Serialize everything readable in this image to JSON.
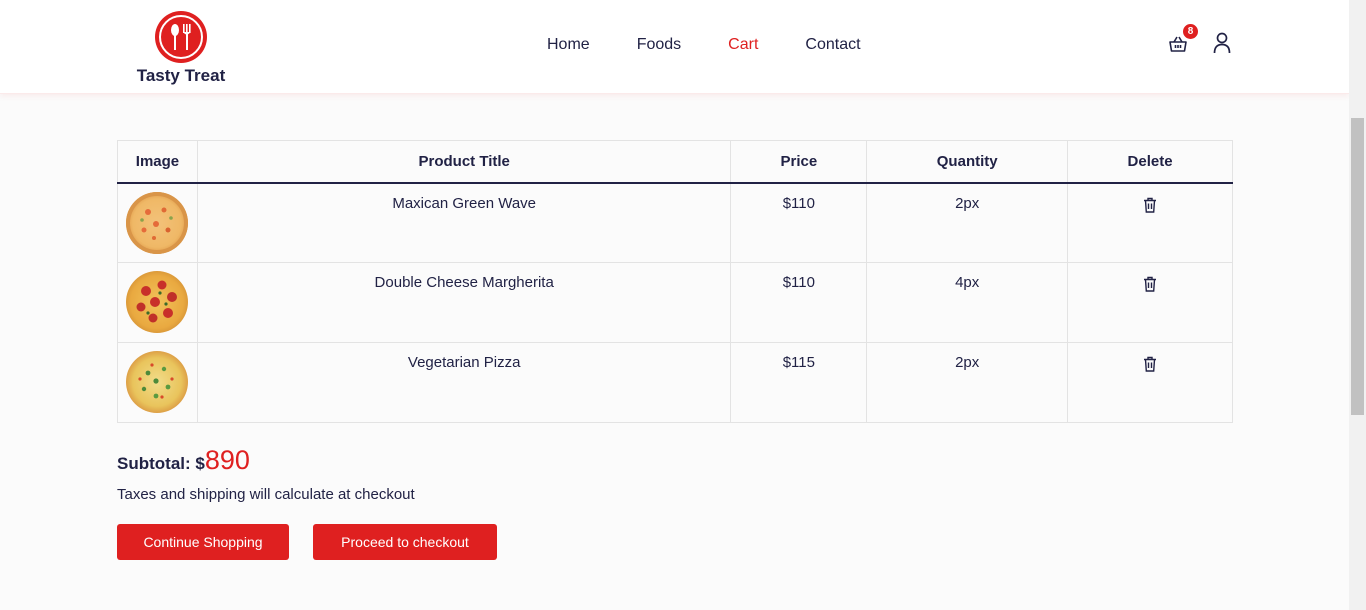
{
  "brand": {
    "name": "Tasty Treat",
    "accent_color": "#df2020",
    "text_color": "#212245"
  },
  "nav": {
    "items": [
      {
        "label": "Home",
        "active": false
      },
      {
        "label": "Foods",
        "active": false
      },
      {
        "label": "Cart",
        "active": true
      },
      {
        "label": "Contact",
        "active": false
      }
    ]
  },
  "header_actions": {
    "cart_icon": "basket-icon",
    "cart_count": "8",
    "user_icon": "user-icon"
  },
  "table": {
    "columns": [
      "Image",
      "Product Title",
      "Price",
      "Quantity",
      "Delete"
    ],
    "rows": [
      {
        "image": "pizza-green-wave",
        "title": "Maxican Green Wave",
        "price": "$110",
        "quantity": "2px",
        "delete_icon": "trash-icon"
      },
      {
        "image": "pizza-margherita",
        "title": "Double Cheese Margherita",
        "price": "$110",
        "quantity": "4px",
        "delete_icon": "trash-icon"
      },
      {
        "image": "pizza-vegetarian",
        "title": "Vegetarian Pizza",
        "price": "$115",
        "quantity": "2px",
        "delete_icon": "trash-icon"
      }
    ]
  },
  "summary": {
    "subtotal_label": "Subtotal: $",
    "subtotal_amount": "890",
    "note": "Taxes and shipping will calculate at checkout"
  },
  "buttons": {
    "continue": "Continue Shopping",
    "checkout": "Proceed to checkout"
  }
}
